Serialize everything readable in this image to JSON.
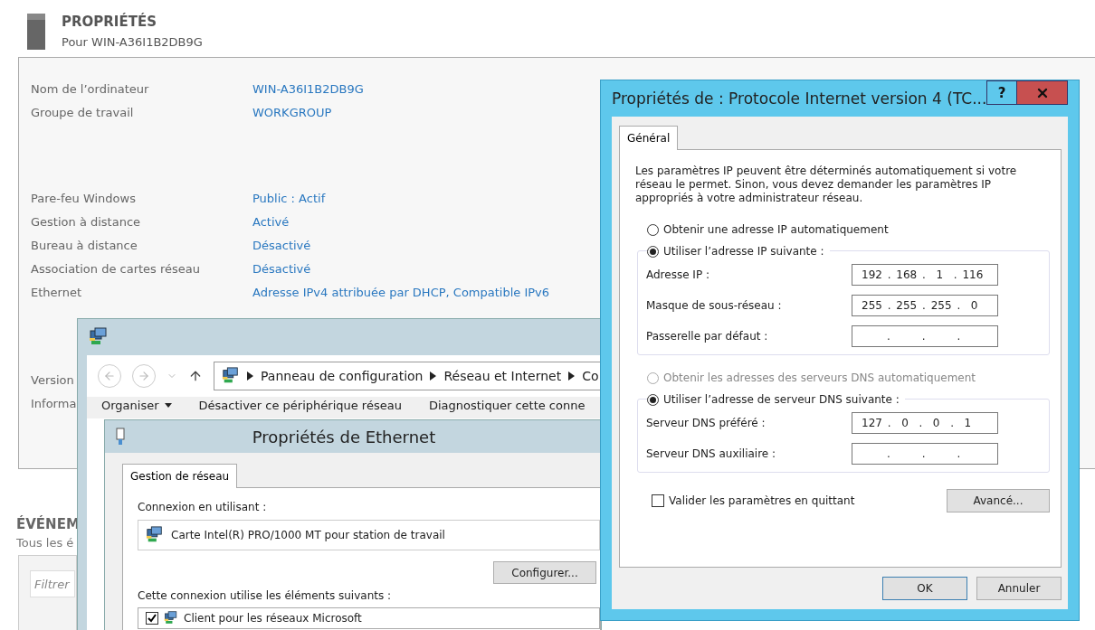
{
  "properties": {
    "title": "PROPRIÉTÉS",
    "subtitle": "Pour WIN-A36I1B2DB9G",
    "sections": [
      [
        {
          "label": "Nom de l’ordinateur",
          "value": "WIN-A36I1B2DB9G"
        },
        {
          "label": "Groupe de travail",
          "value": "WORKGROUP"
        }
      ],
      [
        {
          "label": "Pare-feu Windows",
          "value": "Public : Actif"
        },
        {
          "label": "Gestion à distance",
          "value": "Activé"
        },
        {
          "label": "Bureau à distance",
          "value": "Désactivé"
        },
        {
          "label": "Association de cartes réseau",
          "value": "Désactivé"
        },
        {
          "label": "Ethernet",
          "value": "Adresse IPv4 attribuée par DHCP, Compatible IPv6"
        }
      ],
      [
        {
          "label": "Version"
        },
        {
          "label": "Informa"
        }
      ]
    ]
  },
  "events": {
    "title": "ÉVÉNEM",
    "subtitle": "Tous les é",
    "filter": {
      "placeholder": "Filtrer"
    }
  },
  "explorer": {
    "breadcrumb": [
      "Panneau de configuration",
      "Réseau et Internet",
      "Co"
    ],
    "commands": [
      {
        "label": "Organiser",
        "dropdown": true
      },
      {
        "label": "Désactiver ce périphérique réseau",
        "dropdown": false
      },
      {
        "label": "Diagnostiquer cette conne",
        "dropdown": false
      }
    ]
  },
  "ethernet_dialog": {
    "title": "Propriétés de Ethernet",
    "tabs": [
      {
        "label": "Gestion de réseau",
        "selected": true
      }
    ],
    "connect_label": "Connexion en utilisant :",
    "adapter": "Carte Intel(R) PRO/1000 MT pour station de travail",
    "configure_button": "Configurer...",
    "items_label": "Cette connexion utilise les éléments suivants :",
    "items": [
      {
        "label": "Client pour les réseaux Microsoft",
        "checked": true
      }
    ]
  },
  "ipv4_dialog": {
    "title": "Propriétés de : Protocole Internet version 4 (TC...",
    "help": "?",
    "tabs": [
      {
        "label": "Général",
        "selected": true
      }
    ],
    "intro": "Les paramètres IP peuvent être déterminés automatiquement si votre réseau le permet. Sinon, vous devez demander les paramètres IP appropriés à votre administrateur réseau.",
    "ip_auto": {
      "label": "Obtenir une adresse IP automatiquement",
      "selected": false,
      "disabled": false
    },
    "ip_manual": {
      "label": "Utiliser l’adresse IP suivante :",
      "selected": true,
      "disabled": false
    },
    "ip_fields": [
      {
        "label": "Adresse IP :",
        "value": "192 . 168 .  1  . 116"
      },
      {
        "label": "Masque de sous-réseau :",
        "value": "255 . 255 . 255 .  0"
      },
      {
        "label": "Passerelle par défaut :",
        "value": ".      .      ."
      }
    ],
    "dns_auto": {
      "label": "Obtenir les adresses des serveurs DNS automatiquement",
      "selected": false,
      "disabled": true
    },
    "dns_manual": {
      "label": "Utiliser l’adresse de serveur DNS suivante :",
      "selected": true,
      "disabled": false
    },
    "dns_fields": [
      {
        "label": "Serveur DNS préféré :",
        "value": "127 .  0  .  0  .  1"
      },
      {
        "label": "Serveur DNS auxiliaire :",
        "value": ".      .      ."
      }
    ],
    "validate": {
      "label": "Valider les paramètres en quittant",
      "checked": false
    },
    "advanced_button": "Avancé...",
    "buttons": [
      {
        "label": "OK",
        "default": true
      },
      {
        "label": "Annuler",
        "default": false
      }
    ]
  }
}
